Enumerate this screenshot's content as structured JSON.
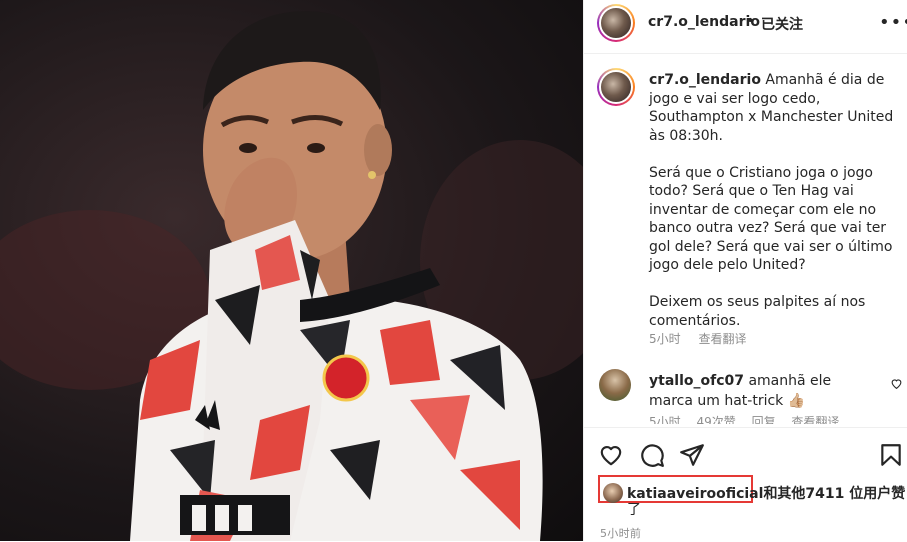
{
  "post": {
    "author": "cr7.o_lendario",
    "follow_status": "已关注",
    "separator": "•",
    "more": "•••"
  },
  "caption": {
    "username": "cr7.o_lendario",
    "paragraph1": "Amanhã é dia de jogo e vai ser logo cedo, Southampton x Manchester United às 08:30h.",
    "paragraph2": "Será que o Cristiano joga o jogo todo? Será que o Ten Hag vai inventar de começar com ele no banco outra vez? Será que vai ter gol dele? Será que vai ser o último jogo dele pelo United?",
    "paragraph3": "Deixem os seus palpites aí nos comentários.",
    "time": "5小时",
    "translate": "查看翻译"
  },
  "comment": {
    "username": "ytallo_ofc07",
    "text": "amanhã ele marca um hat-trick 👍🏼",
    "time": "5小时",
    "likes": "49次赞",
    "reply": "回复",
    "translate": "查看翻译"
  },
  "likes": {
    "username": "katiaaveirooficial",
    "rest": "和其他7411 位用户赞",
    "wrap": "了"
  },
  "timestamp": "5小时前",
  "icons": {
    "like": "heart-icon",
    "comment": "comment-icon",
    "share": "share-icon",
    "save": "bookmark-icon",
    "comment_like": "heart-icon"
  },
  "colors": {
    "highlight_box": "#e53935",
    "text": "#262626",
    "muted": "#8e8e8e"
  }
}
